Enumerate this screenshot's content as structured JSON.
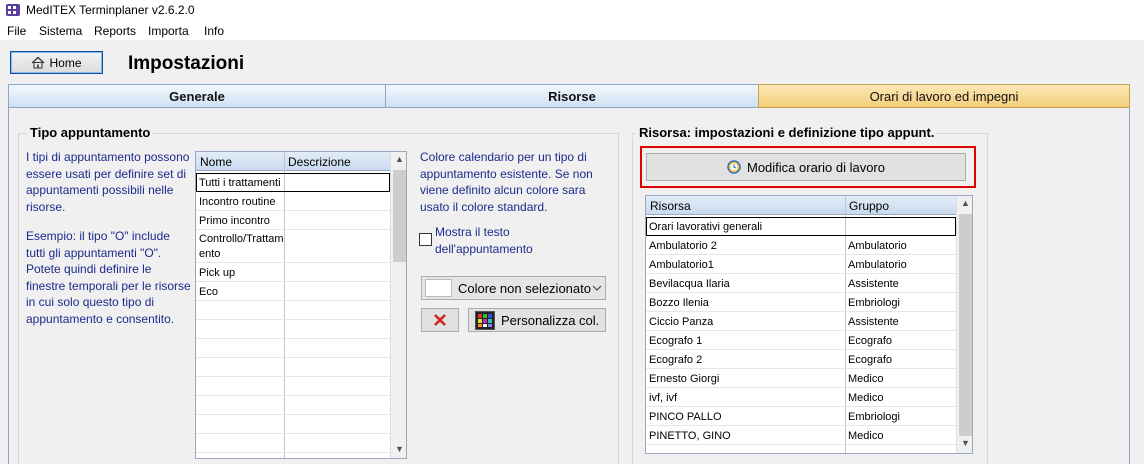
{
  "window": {
    "title": "MedITEX Terminplaner  v2.6.2.0"
  },
  "menu": [
    "File",
    "Sistema",
    "Reports",
    "Importa",
    "Info"
  ],
  "toolbar": {
    "home_label": "Home",
    "page_title": "Impostazioni"
  },
  "tabs": [
    {
      "label": "Generale"
    },
    {
      "label": "Risorse"
    },
    {
      "label": "Orari di lavoro ed impegni"
    }
  ],
  "tipo": {
    "group_title": "Tipo appuntamento",
    "description": "I tipi di appuntamento possono essere usati per definire set di appuntamenti possibili nelle risorse.",
    "example": "Esempio: il tipo \"O\" include tutti gli appuntamenti \"O\". Potete quindi definire le finestre temporali per le risorse in cui solo questo tipo di appuntamento e consentito.",
    "columns": [
      "Nome",
      "Descrizione"
    ],
    "rows": [
      {
        "nome": "Tutti i trattamenti",
        "descrizione": ""
      },
      {
        "nome": "Incontro routine",
        "descrizione": ""
      },
      {
        "nome": "Primo incontro",
        "descrizione": ""
      },
      {
        "nome": "Controllo/Trattam",
        "nome2": "ento",
        "descrizione": ""
      },
      {
        "nome": "Pick up",
        "descrizione": ""
      },
      {
        "nome": "Eco",
        "descrizione": ""
      }
    ],
    "color_info": "Colore calendario per un tipo di appuntamento esistente. Se non viene definito alcun colore sara usato il colore standard.",
    "checkbox_label": "Mostra il testo dell'appuntamento",
    "checkbox_checked": false,
    "color_select": "Colore non selezionato",
    "custom_color_label": "Personalizza col."
  },
  "risorsa": {
    "group_title": "Risorsa: impostazioni e definizione tipo appunt.",
    "modifica_label": "Modifica orario di lavoro",
    "columns": [
      "Risorsa",
      "Gruppo"
    ],
    "rows": [
      {
        "risorsa": "Orari lavorativi generali",
        "gruppo": ""
      },
      {
        "risorsa": "Ambulatorio 2",
        "gruppo": "Ambulatorio"
      },
      {
        "risorsa": "Ambulatorio1",
        "gruppo": "Ambulatorio"
      },
      {
        "risorsa": "Bevilacqua Ilaria",
        "gruppo": "Assistente"
      },
      {
        "risorsa": "Bozzo Ilenia",
        "gruppo": "Embriologi"
      },
      {
        "risorsa": "Ciccio Panza",
        "gruppo": "Assistente"
      },
      {
        "risorsa": "Ecografo 1",
        "gruppo": "Ecografo"
      },
      {
        "risorsa": "Ecografo 2",
        "gruppo": "Ecografo"
      },
      {
        "risorsa": "Ernesto Giorgi",
        "gruppo": "Medico"
      },
      {
        "risorsa": "ivf, ivf",
        "gruppo": "Medico"
      },
      {
        "risorsa": "PINCO PALLO",
        "gruppo": "Embriologi"
      },
      {
        "risorsa": "PINETTO, GINO",
        "gruppo": "Medico"
      }
    ]
  },
  "colors": {
    "tab_active": "#f4cf79",
    "tab_inactive": "#cfe0f3",
    "help_text": "#1b2a8c",
    "highlight_frame": "#e00000"
  }
}
